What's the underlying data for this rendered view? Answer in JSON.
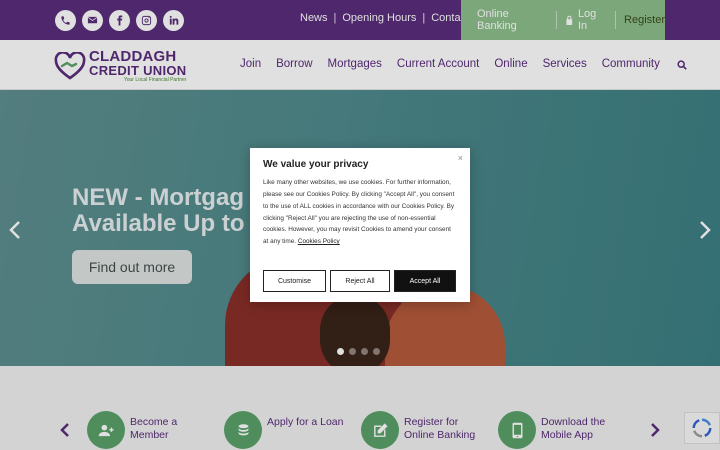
{
  "colors": {
    "brand_purple": "#5b2d7c",
    "brand_green": "#8dbf8b",
    "icon_green": "#5aa16a",
    "hero_teal": "#4f8a8c"
  },
  "topbar": {
    "social_icons": [
      "phone-icon",
      "envelope-icon",
      "facebook-icon",
      "instagram-icon",
      "linkedin-icon"
    ],
    "links": [
      "News",
      "Opening Hours",
      "Contact"
    ],
    "separator": "|",
    "online_banking": "Online Banking",
    "login": "Log In",
    "register": "Register"
  },
  "brand": {
    "line1": "CLADDAGH",
    "line2": "CREDIT UNION",
    "tagline": "Your Local Financial Partner"
  },
  "nav": {
    "items": [
      "Join",
      "Borrow",
      "Mortgages",
      "Current Account",
      "Online",
      "Services",
      "Community"
    ]
  },
  "hero": {
    "headline_line1": "NEW - Mortgag",
    "headline_line2": "Available Up to",
    "cta": "Find out more",
    "slides_count": 4,
    "active_slide": 1
  },
  "quick_links": [
    {
      "line1": "Become a",
      "line2": "Member",
      "icon": "add-user-icon"
    },
    {
      "line1": "Apply for a Loan",
      "line2": "",
      "icon": "coins-icon"
    },
    {
      "line1": "Register for",
      "line2": "Online Banking",
      "icon": "edit-icon"
    },
    {
      "line1": "Download the",
      "line2": "Mobile App",
      "icon": "mobile-icon"
    }
  ],
  "cookie_dialog": {
    "title": "We value your privacy",
    "body": "Like many other websites, we use cookies. For further information, please see our Cookies Policy. By clicking \"Accept All\", you consent to the use of ALL cookies in accordance with our Cookies Policy. By clicking \"Reject All\" you are rejecting the use of non-essential cookies. However, you may revisit Cookies to amend your consent at any time.",
    "policy_link": "Cookies Policy",
    "close": "×",
    "buttons": {
      "customise": "Customise",
      "reject": "Reject All",
      "accept": "Accept All"
    }
  }
}
